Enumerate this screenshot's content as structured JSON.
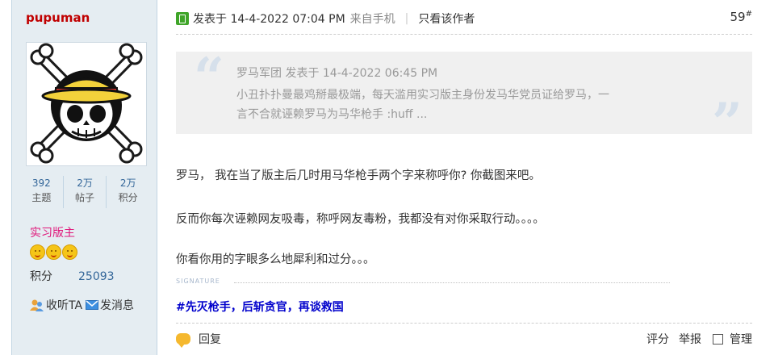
{
  "author": {
    "username": "pupuman",
    "stats": [
      {
        "value": "392",
        "label": "主题"
      },
      {
        "value": "2万",
        "label": "帖子"
      },
      {
        "value": "2万",
        "label": "积分"
      }
    ],
    "rank": "实习版主",
    "credits_label": "积分",
    "credits_value": "25093",
    "follow_label": "收听TA",
    "message_label": "发消息"
  },
  "post": {
    "posted_text": "发表于 14-4-2022 07:04 PM",
    "via_text": "来自手机",
    "separator": "|",
    "only_author": "只看该作者",
    "floor_number": "59",
    "floor_suffix": "#",
    "quote": {
      "header": "罗马军团 发表于 14-4-2022 06:45 PM",
      "line1": "小丑扑扑曼最鸡掰最极端，每天滥用实习版主身份发马华党员证给罗马，一",
      "line2": "言不合就诬赖罗马为马华枪手 :huff ..."
    },
    "body": [
      "罗马， 我在当了版主后几时用马华枪手两个字来称呼你? 你截图来吧。",
      "反而你每次诬赖网友吸毒，称呼网友毒粉，我都没有对你采取行动。。。。",
      "你看你用的字眼多么地犀利和过分。。。"
    ],
    "signature_label": "SIGNATURE",
    "signature_text": "#先灭枪手，后斩贪官，再谈救国"
  },
  "footer": {
    "reply_label": "回复",
    "rate_label": "评分",
    "report_label": "举报",
    "manage_label": "管理"
  },
  "colors": {
    "username": "#c00000",
    "rank": "#e0167a",
    "sidebar_bg": "#e5edf2",
    "signature": "#0000cc"
  }
}
